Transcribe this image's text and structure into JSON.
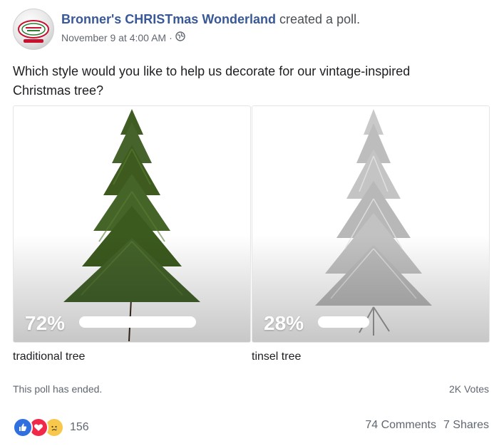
{
  "post": {
    "author": "Bronner's CHRISTmas Wonderland",
    "action": "created a poll.",
    "timestamp": "November 9 at 4:00 AM",
    "separator": "·",
    "privacy_icon": "globe-icon",
    "avatar_icon": "bronners-logo"
  },
  "poll": {
    "question": "Which style would you like to help us decorate for our vintage-inspired Christmas tree?",
    "options": [
      {
        "label": "traditional tree",
        "percent_text": "72%",
        "percent": 72,
        "image": "green-christmas-tree"
      },
      {
        "label": "tinsel tree",
        "percent_text": "28%",
        "percent": 28,
        "image": "silver-tinsel-tree"
      }
    ],
    "status": "This poll has ended.",
    "votes": "2K Votes"
  },
  "engagement": {
    "reaction_icons": [
      "like-reaction-icon",
      "love-reaction-icon",
      "sad-reaction-icon"
    ],
    "reaction_count": "156",
    "comments": "74 Comments",
    "shares": "7 Shares"
  },
  "colors": {
    "link": "#385898",
    "tree_green": "#3e5a1e",
    "tree_silver": "#bdbdbd",
    "like": "#2f6fe0",
    "love": "#f0284a",
    "sad": "#f7c84b"
  }
}
